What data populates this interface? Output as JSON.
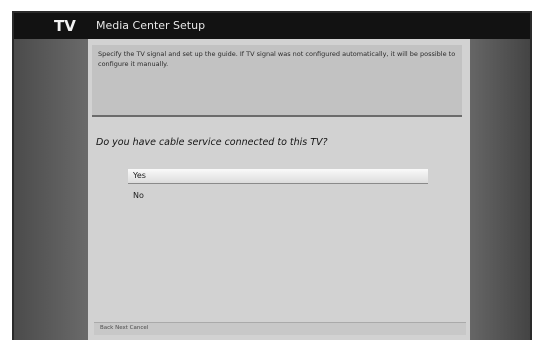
{
  "window": {
    "logo_text": "TV",
    "title": "Media Center Setup"
  },
  "description": {
    "text": "Specify the TV signal and set up the guide. If TV signal was not configured automatically, it will be possible to configure it manually."
  },
  "question": {
    "text": "Do you have cable service connected to this TV?"
  },
  "options": [
    {
      "label": "Yes",
      "selected": true
    },
    {
      "label": "No",
      "selected": false
    }
  ],
  "footer": {
    "text": "Back   Next   Cancel"
  }
}
